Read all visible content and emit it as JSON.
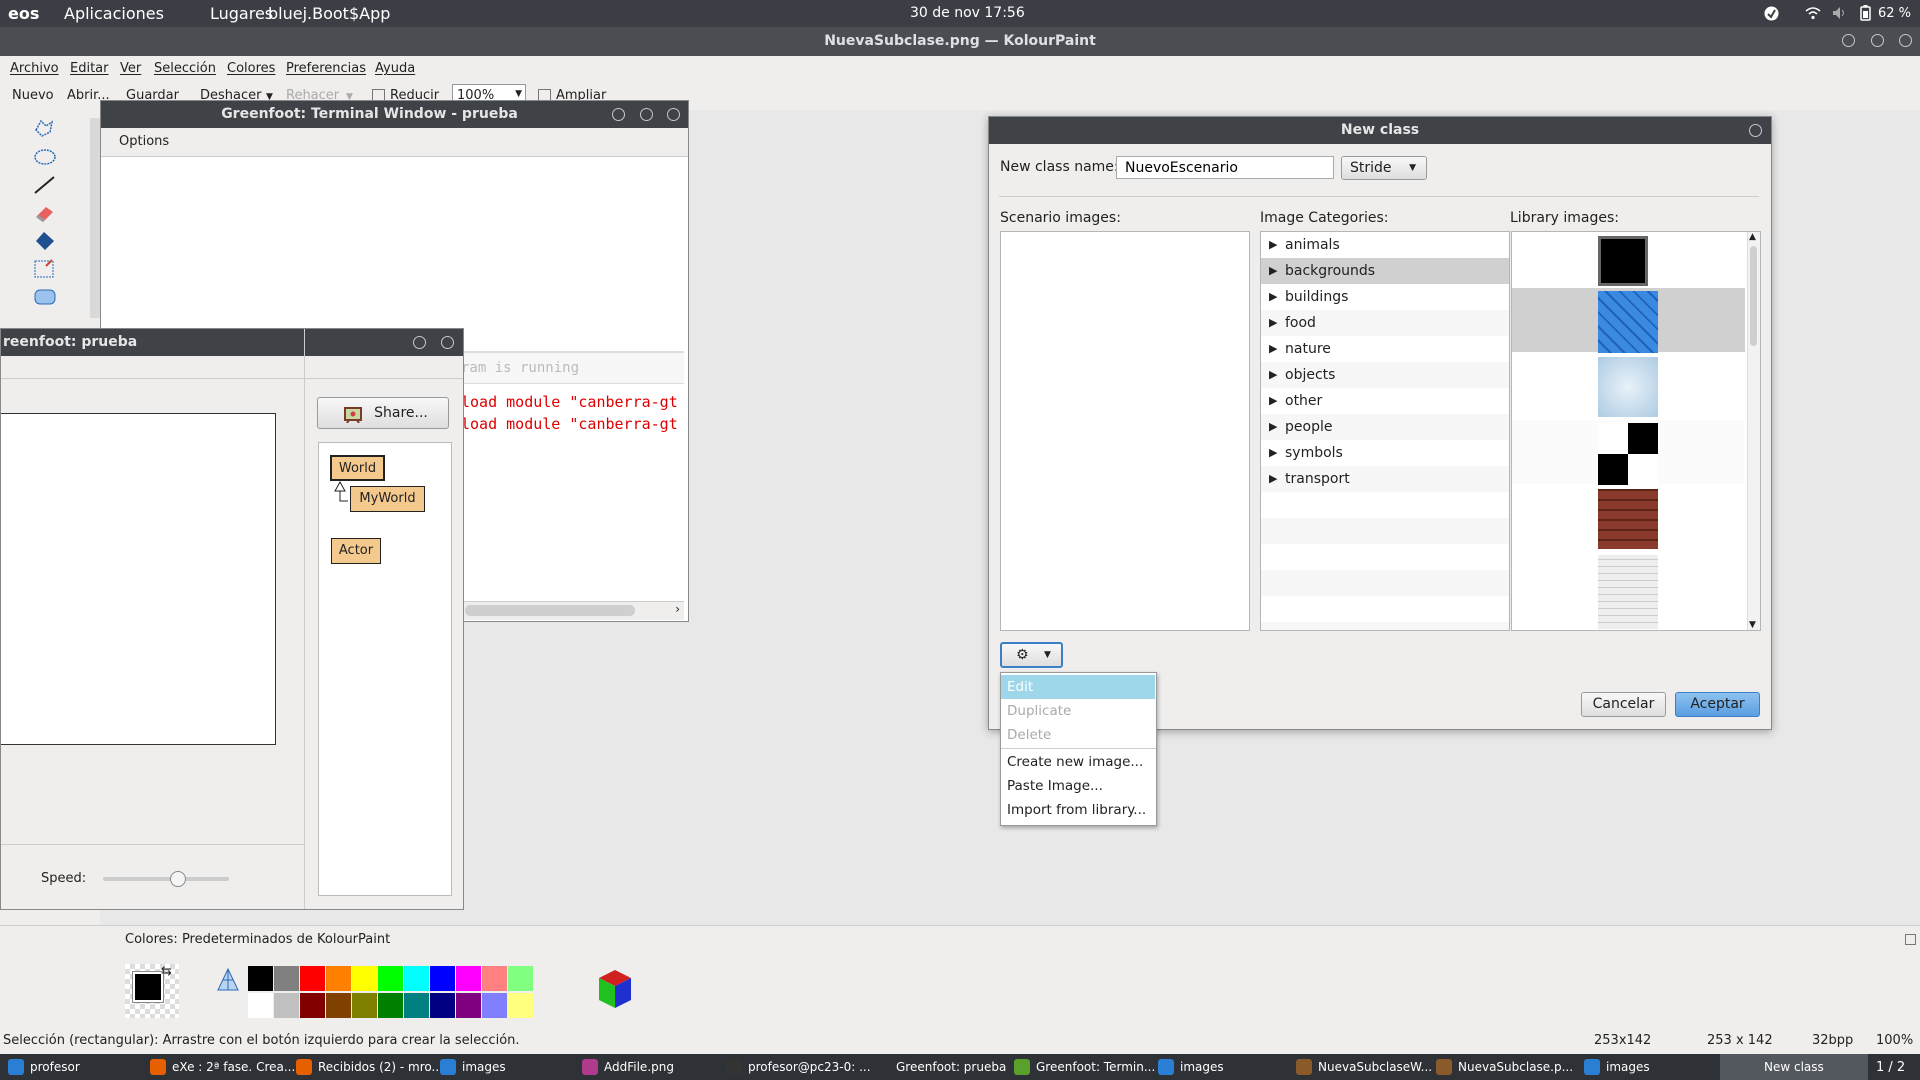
{
  "top_panel": {
    "logo": "eos",
    "menu": [
      "Aplicaciones",
      "Lugares",
      "bluej.Boot$App"
    ],
    "clock": "30 de nov  17:56",
    "battery": "62 %"
  },
  "kolourpaint": {
    "title": "NuevaSubclase.png — KolourPaint",
    "menus": [
      "Archivo",
      "Editar",
      "Ver",
      "Selección",
      "Colores",
      "Preferencias",
      "Ayuda"
    ],
    "toolbar": {
      "new": "Nuevo",
      "open": "Abrir...",
      "save": "Guardar",
      "undo": "Deshacer",
      "redo": "Rehacer",
      "zoom_out": "Reducir",
      "zoom_value": "100%",
      "zoom_in": "Ampliar"
    },
    "colors_label": "Colores: Predeterminados de KolourPaint",
    "palette_top": [
      "#000000",
      "#808080",
      "#ff0000",
      "#ff8000",
      "#ffff00",
      "#00ff00",
      "#00ffff",
      "#0000ff",
      "#ff00ff",
      "#ff8080",
      "#80ff80"
    ],
    "palette_bottom": [
      "#ffffff",
      "#c0c0c0",
      "#800000",
      "#804000",
      "#808000",
      "#008000",
      "#008080",
      "#000080",
      "#800080",
      "#8080ff",
      "#ffff80"
    ],
    "status": {
      "message": "Selección (rectangular): Arrastre con el botón izquierdo para crear la selección.",
      "size1": "253x142",
      "size2": "253 x 142",
      "depth": "32bpp",
      "zoom": "100%"
    }
  },
  "terminal": {
    "title": "Greenfoot: Terminal Window - prueba",
    "menu": "Options",
    "running": "ram is running",
    "error1": "load module \"canberra-gt",
    "error2": "load module \"canberra-gt"
  },
  "greenfoot": {
    "title": "reenfoot: prueba",
    "share": "Share...",
    "classes": {
      "world": "World",
      "myworld": "MyWorld",
      "actor": "Actor"
    },
    "speed_label": "Speed:",
    "speed_value": 0.6
  },
  "new_class": {
    "title": "New class",
    "name_label": "New class name:",
    "name_value": "NuevoEscenario",
    "language": "Stride",
    "scenario_images_label": "Scenario images:",
    "categories_label": "Image Categories:",
    "library_label": "Library images:",
    "categories": [
      "animals",
      "backgrounds",
      "buildings",
      "food",
      "nature",
      "objects",
      "other",
      "people",
      "symbols",
      "transport"
    ],
    "selected_category": "backgrounds",
    "cancel": "Cancelar",
    "accept": "Aceptar",
    "menu": {
      "edit": "Edit",
      "duplicate": "Duplicate",
      "delete": "Delete",
      "create": "Create new image...",
      "paste": "Paste Image...",
      "import": "Import from library..."
    }
  },
  "taskbar": [
    {
      "label": "profesor",
      "color": "#2a7fd4"
    },
    {
      "label": "eXe : 2ª fase. Crea...",
      "color": "#e66000"
    },
    {
      "label": "Recibidos (2) - mro...",
      "color": "#e66000"
    },
    {
      "label": "images",
      "color": "#2a7fd4"
    },
    {
      "label": "AddFile.png",
      "color": "#b03a8c"
    },
    {
      "label": "profesor@pc23-0: ...",
      "color": "#333333"
    },
    {
      "label": "Greenfoot: prueba",
      "color": "#2e3136"
    },
    {
      "label": "Greenfoot: Termin...",
      "color": "#5aa02c"
    },
    {
      "label": "images",
      "color": "#2a7fd4"
    },
    {
      "label": "NuevaSubclaseW...",
      "color": "#8a5a2a"
    },
    {
      "label": "NuevaSubclase.p...",
      "color": "#8a5a2a"
    },
    {
      "label": "images",
      "color": "#2a7fd4"
    },
    {
      "label": "New class",
      "color": "#555555"
    }
  ],
  "workspace": "1 / 2"
}
